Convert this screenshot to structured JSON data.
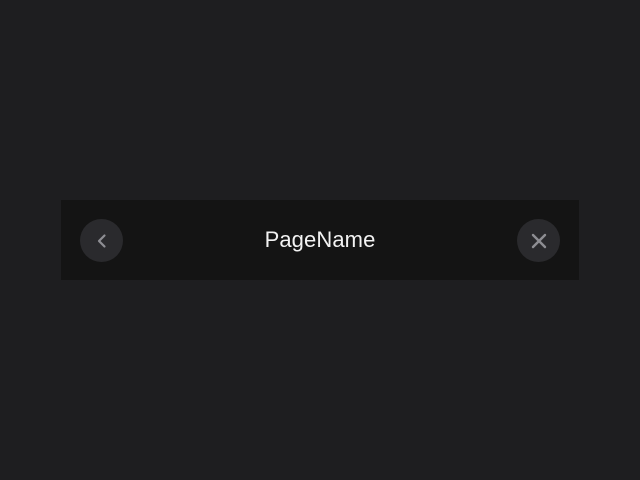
{
  "navbar": {
    "title": "PageName",
    "back_icon": "chevron-left-icon",
    "close_icon": "close-icon"
  },
  "colors": {
    "page_background": "#1e1e20",
    "navbar_background": "#141414",
    "button_background": "#2a2a2d",
    "icon_color": "#8e8e93",
    "title_color": "#f2f2f2"
  }
}
